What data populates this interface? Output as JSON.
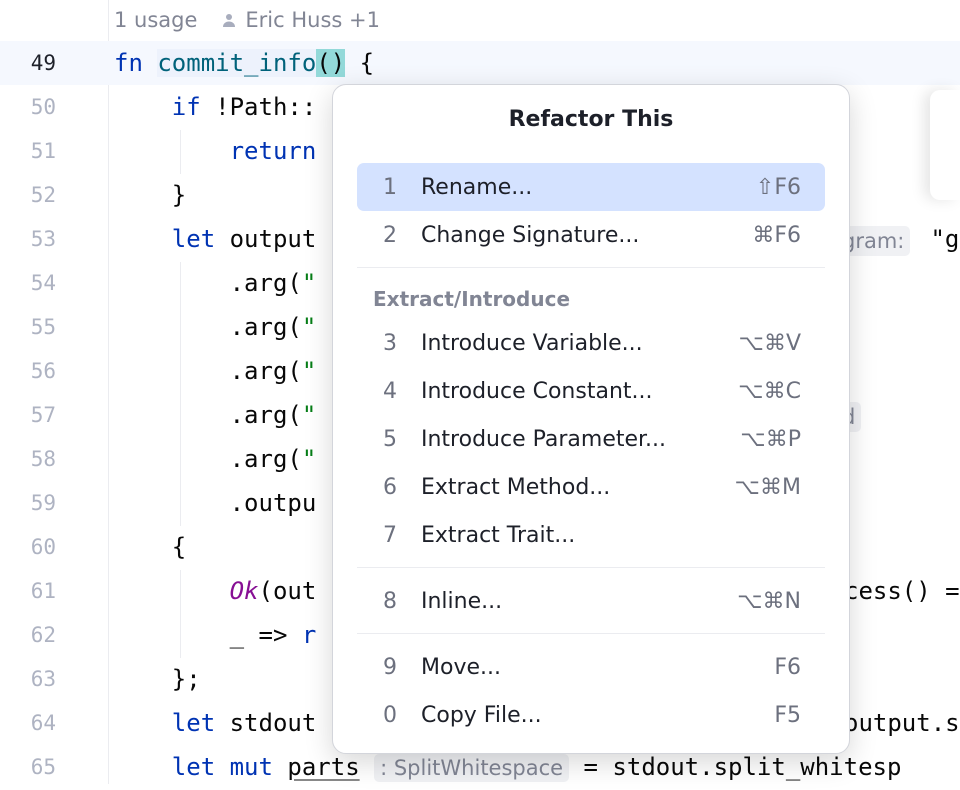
{
  "editor": {
    "hint": {
      "usage": "1 usage",
      "author": "Eric Huss +1"
    },
    "lines": [
      {
        "num": "49",
        "text": ""
      },
      {
        "num": "50",
        "text": "    if !Path::"
      },
      {
        "num": "51",
        "text": "        return"
      },
      {
        "num": "52",
        "text": "    }"
      },
      {
        "num": "53",
        "text": "    let output"
      },
      {
        "num": "54",
        "text": "        .arg(\""
      },
      {
        "num": "55",
        "text": "        .arg(\""
      },
      {
        "num": "56",
        "text": "        .arg(\""
      },
      {
        "num": "57",
        "text": "        .arg(\""
      },
      {
        "num": "58",
        "text": "        .arg(\""
      },
      {
        "num": "59",
        "text": "        .outpu"
      },
      {
        "num": "60",
        "text": "    {"
      },
      {
        "num": "61",
        "text": ""
      },
      {
        "num": "62",
        "text": "        _ => r"
      },
      {
        "num": "63",
        "text": "    };"
      },
      {
        "num": "64",
        "text": "    let stdout"
      },
      {
        "num": "65",
        "text": ""
      }
    ],
    "line49": {
      "kw": "fn ",
      "name": "commit_info",
      "paren": "()",
      "rest": " {"
    },
    "line61": {
      "ok": "Ok",
      "rest": "(out"
    },
    "line65": {
      "kw": "    let mut ",
      "var": "parts",
      "inlay": ": SplitWhitespace",
      "rest": " = stdout.split_whitesp"
    },
    "side": {
      "s53_inlay": "gram:",
      "s53_str": " \"g",
      "s57_inlay": "d",
      "s61": "cess() =",
      "s64": "output.s"
    }
  },
  "popup": {
    "title": "Refactor This",
    "items": [
      {
        "num": "1",
        "label": "Rename...",
        "shortcut": "⇧F6"
      },
      {
        "num": "2",
        "label": "Change Signature...",
        "shortcut": "⌘F6"
      },
      {
        "num": "3",
        "label": "Introduce Variable...",
        "shortcut": "⌥⌘V"
      },
      {
        "num": "4",
        "label": "Introduce Constant...",
        "shortcut": "⌥⌘C"
      },
      {
        "num": "5",
        "label": "Introduce Parameter...",
        "shortcut": "⌥⌘P"
      },
      {
        "num": "6",
        "label": "Extract Method...",
        "shortcut": "⌥⌘M"
      },
      {
        "num": "7",
        "label": "Extract Trait...",
        "shortcut": ""
      },
      {
        "num": "8",
        "label": "Inline...",
        "shortcut": "⌥⌘N"
      },
      {
        "num": "9",
        "label": "Move...",
        "shortcut": "F6"
      },
      {
        "num": "0",
        "label": "Copy File...",
        "shortcut": "F5"
      }
    ],
    "group_extract": "Extract/Introduce"
  },
  "colors": {
    "selection": "#d4e2ff",
    "keyword": "#0033b3",
    "function": "#00627a",
    "string": "#067d17",
    "paren_highlight": "#93d9d9"
  },
  "icons": {
    "author": "person-icon"
  }
}
